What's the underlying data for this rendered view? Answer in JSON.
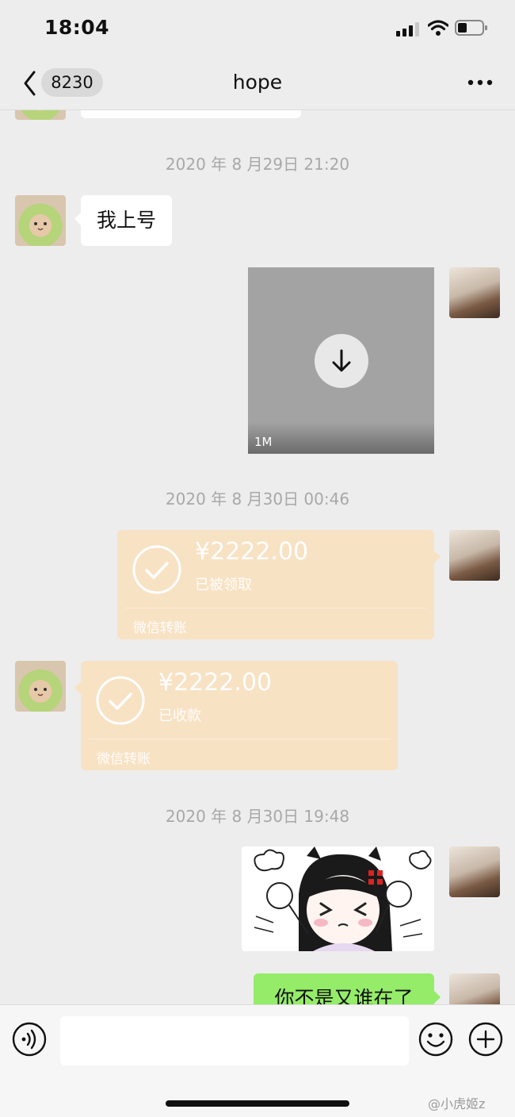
{
  "status_bar": {
    "time": "18:04"
  },
  "nav": {
    "unread_count": "8230",
    "title": "hope"
  },
  "messages": {
    "ts1": "2020 年 8 月29日 21:20",
    "msg1_text": "我上号",
    "video_size": "1M",
    "ts2": "2020 年 8 月30日 00:46",
    "transfer_out": {
      "amount": "¥2222.00",
      "status": "已被领取",
      "footer": "微信转账"
    },
    "transfer_in": {
      "amount": "¥2222.00",
      "status": "已收款",
      "footer": "微信转账"
    },
    "ts3": "2020 年 8 月30日 19:48",
    "last_text": "你不是又谁在了"
  },
  "watermark": "@小虎姬z",
  "colors": {
    "background": "#ededed",
    "transfer": "#f8e2c4",
    "green_bubble": "#95ec69"
  },
  "icons": [
    "back-chevron",
    "more-dots",
    "download-arrow",
    "check-circle",
    "voice-icon",
    "emoji-icon",
    "plus-icon"
  ]
}
